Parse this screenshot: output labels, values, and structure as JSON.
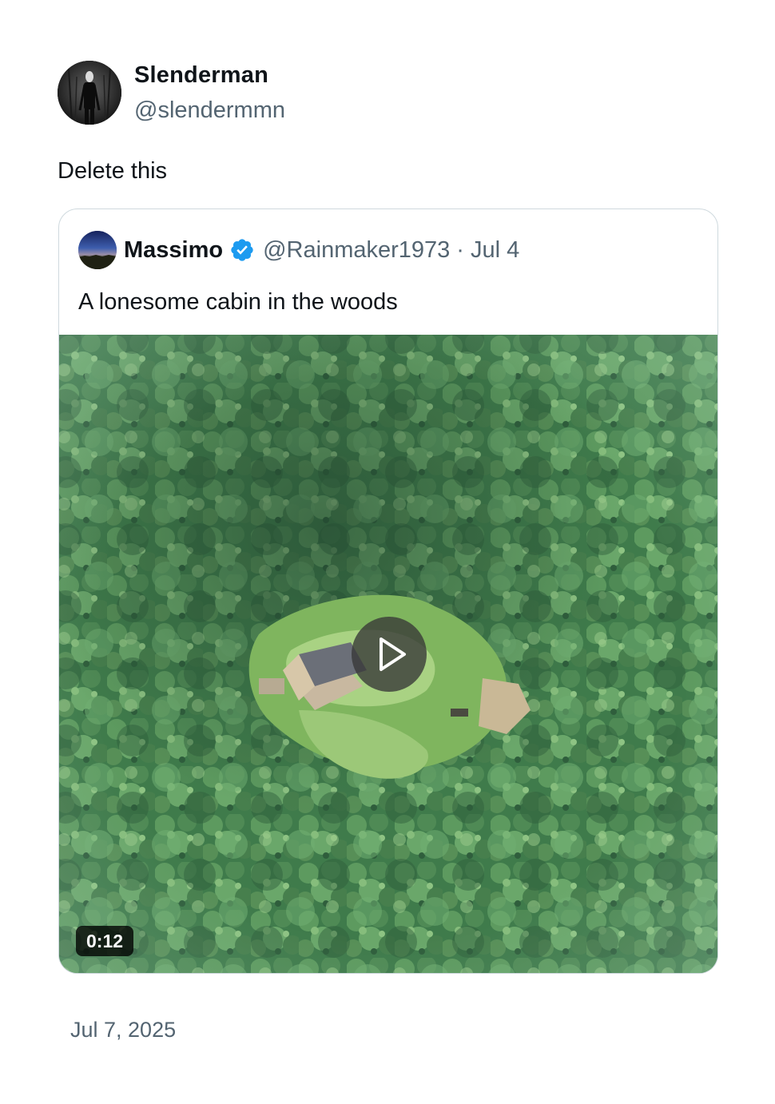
{
  "author": {
    "display_name": "Slenderman",
    "handle": "@slendermmn",
    "avatar_icon": "slenderman-avatar-icon"
  },
  "tweet": {
    "text": "Delete this",
    "timestamp": "Jul 7, 2025"
  },
  "quoted_tweet": {
    "display_name": "Massimo",
    "verified": true,
    "verified_color": "#1d9bf0",
    "handle": "@Rainmaker1973",
    "separator": "·",
    "date": "Jul 4",
    "text": "A lonesome cabin in the woods",
    "video": {
      "duration": "0:12",
      "play_icon": "play-icon"
    }
  },
  "colors": {
    "text_primary": "#0f1419",
    "text_secondary": "#536471",
    "card_border": "#cfd9de"
  }
}
